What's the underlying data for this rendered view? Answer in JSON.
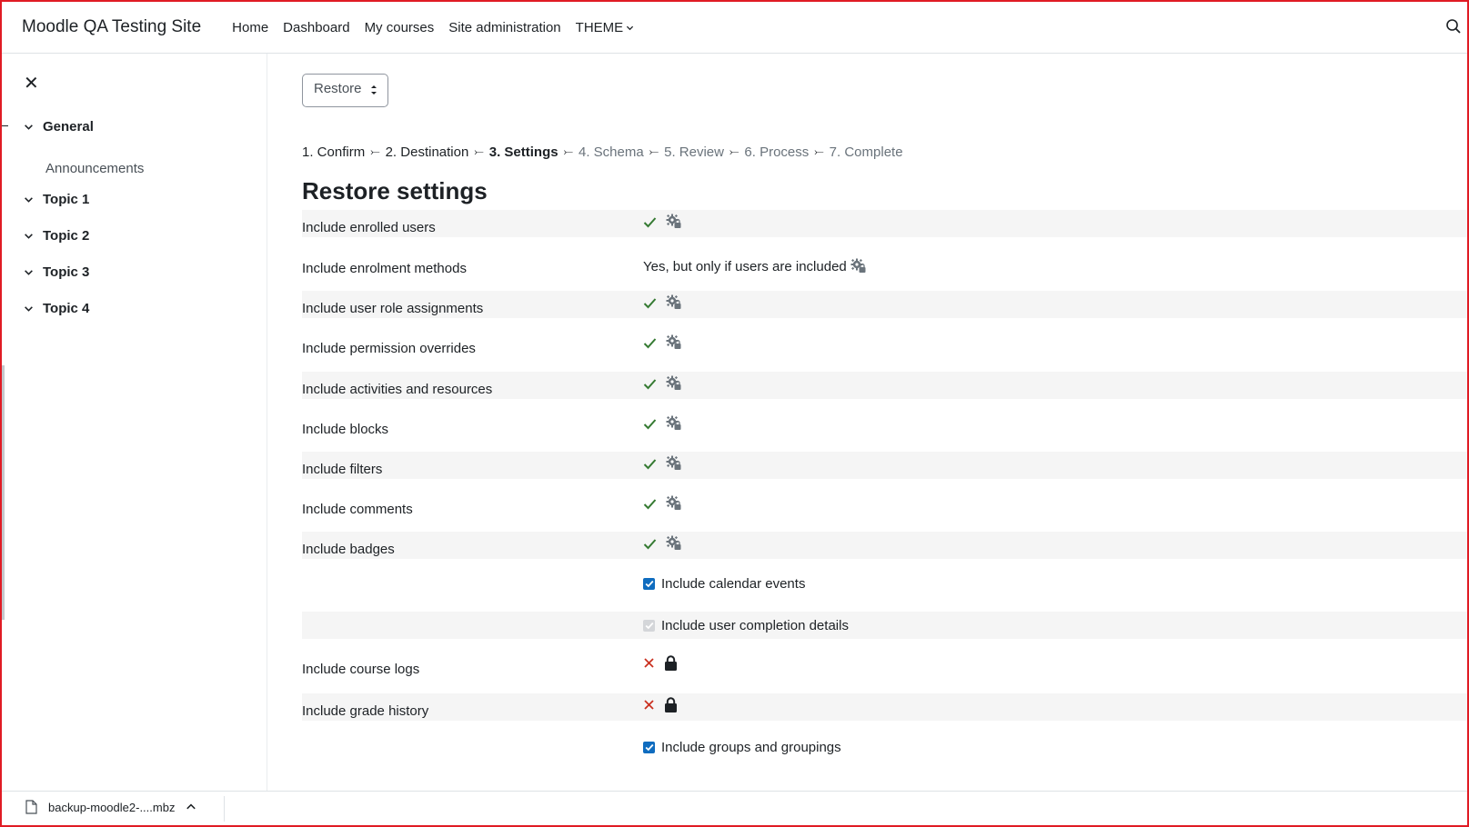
{
  "navbar": {
    "brand": "Moodle QA Testing Site",
    "links": [
      "Home",
      "Dashboard",
      "My courses",
      "Site administration"
    ],
    "theme_label": "THEME",
    "search_icon": "search-icon"
  },
  "drawer": {
    "close_icon": "close-icon",
    "sections": [
      {
        "label": "General"
      },
      {
        "label": "Topic 1"
      },
      {
        "label": "Topic 2"
      },
      {
        "label": "Topic 3"
      },
      {
        "label": "Topic 4"
      }
    ],
    "sub_items": [
      "Announcements"
    ]
  },
  "main": {
    "select_value": "Restore",
    "steps": [
      {
        "label": "1. Confirm",
        "state": "done"
      },
      {
        "label": "2. Destination",
        "state": "done"
      },
      {
        "label": "3. Settings",
        "state": "current"
      },
      {
        "label": "4. Schema",
        "state": "future"
      },
      {
        "label": "5. Review",
        "state": "future"
      },
      {
        "label": "6. Process",
        "state": "future"
      },
      {
        "label": "7. Complete",
        "state": "future"
      }
    ],
    "heading": "Restore settings",
    "settings": [
      {
        "label": "Include enrolled users",
        "value": "check-locked"
      },
      {
        "label": "Include enrolment methods",
        "value": "text",
        "text": "Yes, but only if users are included"
      },
      {
        "label": "Include user role assignments",
        "value": "check-locked"
      },
      {
        "label": "Include permission overrides",
        "value": "check-locked"
      },
      {
        "label": "Include activities and resources",
        "value": "check-locked"
      },
      {
        "label": "Include blocks",
        "value": "check-locked"
      },
      {
        "label": "Include filters",
        "value": "check-locked"
      },
      {
        "label": "Include comments",
        "value": "check-locked"
      },
      {
        "label": "Include badges",
        "value": "check-locked"
      },
      {
        "label": "",
        "value": "checkbox",
        "text": "Include calendar events",
        "checked": true,
        "disabled": false
      },
      {
        "label": "",
        "value": "checkbox",
        "text": "Include user completion details",
        "checked": true,
        "disabled": true
      },
      {
        "label": "Include course logs",
        "value": "cross-lock"
      },
      {
        "label": "Include grade history",
        "value": "cross-lock"
      },
      {
        "label": "",
        "value": "checkbox",
        "text": "Include groups and groupings",
        "checked": true,
        "disabled": false
      }
    ]
  },
  "downloads": {
    "file_name": "backup-moodle2-....mbz"
  },
  "colors": {
    "check_green": "#357a32",
    "cross_red": "#ca3120",
    "checkbox_blue": "#0f6cbf",
    "frame_red": "#e01b24"
  }
}
